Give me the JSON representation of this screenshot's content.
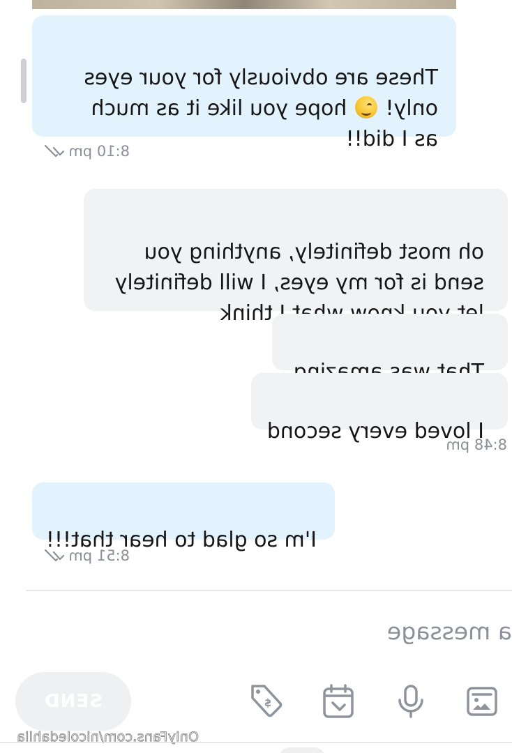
{
  "messages": [
    {
      "direction": "incoming",
      "text_before_emoji": "These are obviously for your eyes\nonly! ",
      "emoji": "winking-face",
      "text_after_emoji": " hope you like it as much\nas I did!!",
      "time": "8:10 pm"
    },
    {
      "direction": "outgoing",
      "text": "oh most definitely, anything you\nsend is for my eyes, I will definitely\nlet you know what I think"
    },
    {
      "direction": "outgoing",
      "text": "That was amazing"
    },
    {
      "direction": "outgoing",
      "text": "I loved every second",
      "time": "8:48 pm"
    },
    {
      "direction": "incoming",
      "text": "I'm so glad to hear that!!!",
      "time": "8:51 pm"
    }
  ],
  "composer": {
    "placeholder": "a message",
    "send_label": "SEND",
    "tools": [
      "image-icon",
      "microphone-icon",
      "calendar-icon",
      "price-tag-icon"
    ]
  },
  "watermark": "OnlyFans.com/nicoledahlia",
  "colors": {
    "incoming_bubble": "#e2f3fd",
    "outgoing_bubble": "#f1f2f4",
    "meta_text": "#8a8f98",
    "icon": "#8f949c"
  }
}
